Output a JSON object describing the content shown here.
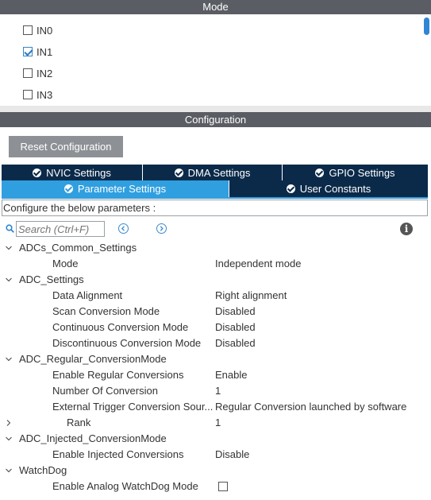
{
  "mode": {
    "header": "Mode",
    "items": [
      {
        "label": "IN0",
        "checked": false
      },
      {
        "label": "IN1",
        "checked": true
      },
      {
        "label": "IN2",
        "checked": false
      },
      {
        "label": "IN3",
        "checked": false
      }
    ]
  },
  "configuration": {
    "header": "Configuration",
    "reset_button": "Reset Configuration",
    "tabs_row1": [
      {
        "label": "NVIC Settings",
        "checked": true
      },
      {
        "label": "DMA Settings",
        "checked": true
      },
      {
        "label": "GPIO Settings",
        "checked": true
      }
    ],
    "tabs_row2": [
      {
        "label": "Parameter Settings",
        "checked": true,
        "active": true
      },
      {
        "label": "User Constants",
        "checked": true,
        "active": false
      }
    ],
    "configure_text": "Configure the below parameters :",
    "search": {
      "placeholder": "Search (Ctrl+F)"
    },
    "tree": [
      {
        "type": "group",
        "label": "ADCs_Common_Settings",
        "expanded": true
      },
      {
        "type": "param",
        "label": "Mode",
        "value": "Independent mode"
      },
      {
        "type": "group",
        "label": "ADC_Settings",
        "expanded": true
      },
      {
        "type": "param",
        "label": "Data Alignment",
        "value": "Right alignment"
      },
      {
        "type": "param",
        "label": "Scan Conversion Mode",
        "value": "Disabled"
      },
      {
        "type": "param",
        "label": "Continuous Conversion Mode",
        "value": "Disabled"
      },
      {
        "type": "param",
        "label": "Discontinuous Conversion Mode",
        "value": "Disabled"
      },
      {
        "type": "group",
        "label": "ADC_Regular_ConversionMode",
        "expanded": true
      },
      {
        "type": "param",
        "label": "Enable Regular Conversions",
        "value": "Enable"
      },
      {
        "type": "param",
        "label": "Number Of Conversion",
        "value": "1"
      },
      {
        "type": "param",
        "label": "External Trigger Conversion Sour...",
        "value": "Regular Conversion launched by software"
      },
      {
        "type": "subgroup",
        "label": "Rank",
        "value": "1",
        "expanded": false
      },
      {
        "type": "group",
        "label": "ADC_Injected_ConversionMode",
        "expanded": true
      },
      {
        "type": "param",
        "label": "Enable Injected Conversions",
        "value": "Disable"
      },
      {
        "type": "group",
        "label": "WatchDog",
        "expanded": true
      },
      {
        "type": "param-checkbox",
        "label": "Enable Analog WatchDog Mode",
        "checked": false
      }
    ]
  },
  "colors": {
    "header_bg": "#5a5d63",
    "tab_dark": "#0b2a4a",
    "tab_active": "#2f9fe0",
    "reset_button_bg": "#8d9196"
  }
}
